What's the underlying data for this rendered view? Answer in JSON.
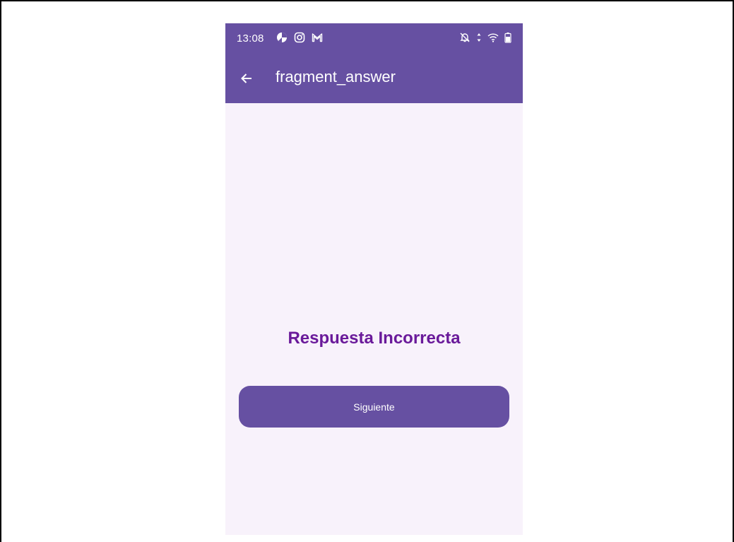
{
  "status_bar": {
    "time": "13:08",
    "left_icons": [
      "pie-chart-icon",
      "instagram-icon",
      "gmail-icon"
    ],
    "right_icons": [
      "bell-off-icon",
      "data-arrows-icon",
      "wifi-icon",
      "battery-icon"
    ]
  },
  "toolbar": {
    "title": "fragment_answer",
    "back_icon": "arrow-left-icon"
  },
  "main": {
    "result_text": "Respuesta Incorrecta",
    "next_button_label": "Siguiente"
  },
  "colors": {
    "app_bar": "#6650a2",
    "background": "#f8f2fb",
    "result_text": "#6a1a9a",
    "button": "#6650a2"
  }
}
